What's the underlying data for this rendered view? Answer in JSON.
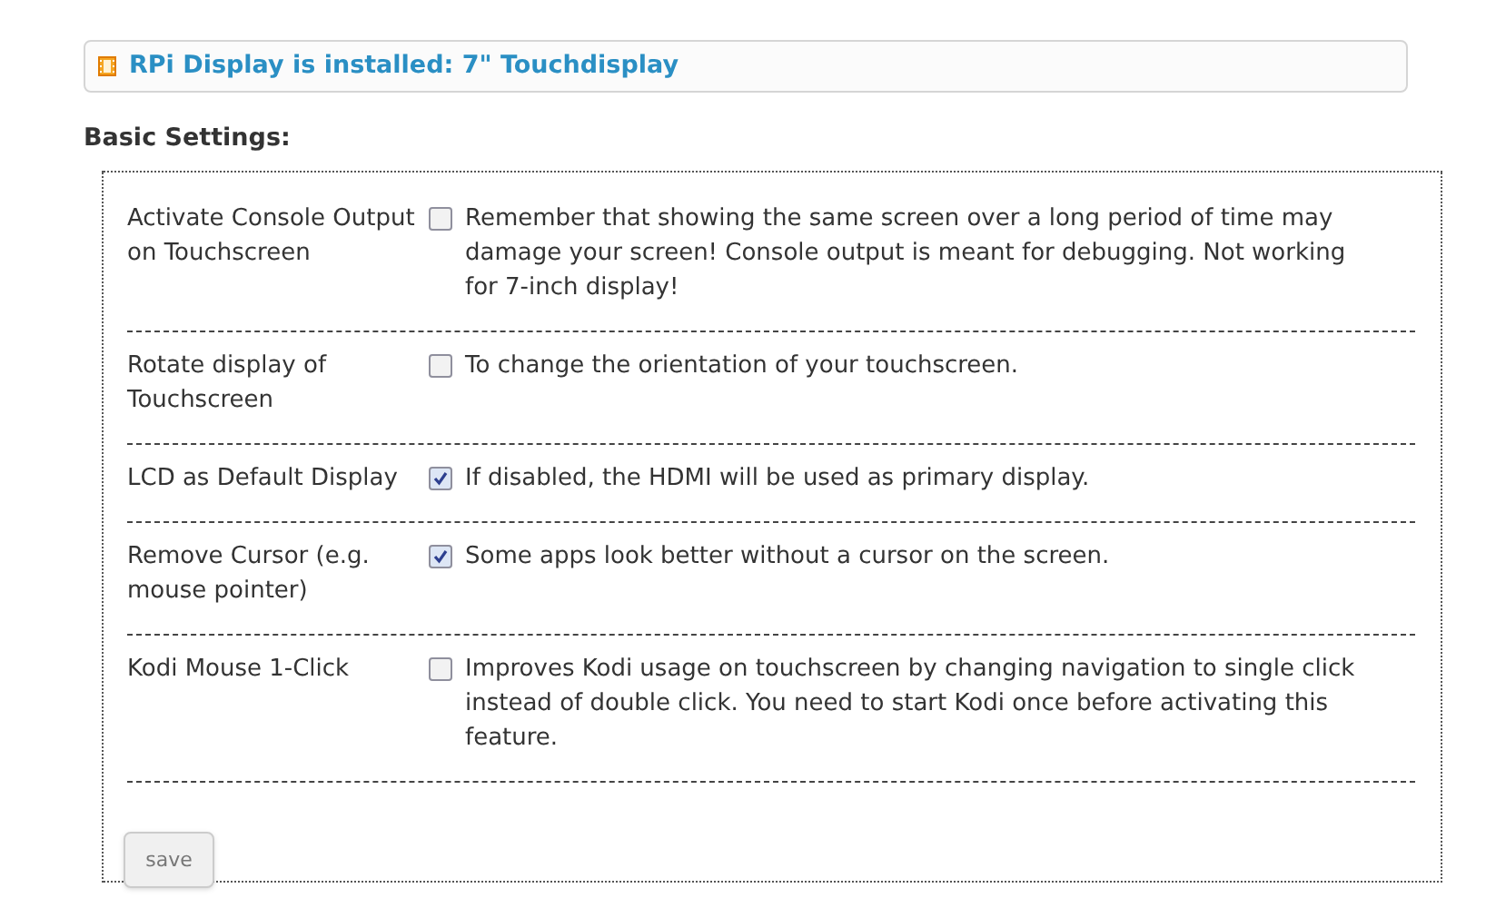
{
  "banner": {
    "text": "RPi Display is installed: 7\" Touchdisplay"
  },
  "section_title": "Basic Settings:",
  "settings": [
    {
      "label": "Activate Console Output on Touchscreen",
      "checked": false,
      "description": "Remember that showing the same screen over a long period of time may damage your screen! Console output is meant for debugging. Not working for 7-inch display!"
    },
    {
      "label": "Rotate display of Touchscreen",
      "checked": false,
      "description": "To change the orientation of your touchscreen."
    },
    {
      "label": "LCD as Default Display",
      "checked": true,
      "description": "If disabled, the HDMI will be used as primary display."
    },
    {
      "label": "Remove Cursor (e.g. mouse pointer)",
      "checked": true,
      "description": "Some apps look better without a cursor on the screen."
    },
    {
      "label": "Kodi Mouse 1-Click",
      "checked": false,
      "description": "Improves Kodi usage on touchscreen by changing navigation to single click instead of double click. You need to start Kodi once before activating this feature."
    }
  ],
  "save_button": "save"
}
